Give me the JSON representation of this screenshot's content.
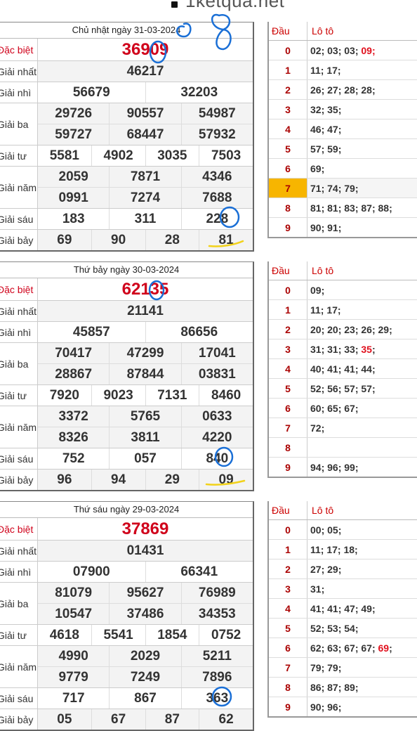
{
  "header": {
    "domain": "1ketqua.net"
  },
  "days": [
    {
      "date": "Chủ nhật ngày 31-03-2024",
      "prizes": [
        {
          "name": "Đặc biệt",
          "lines": [
            [
              "36909"
            ]
          ],
          "special": true
        },
        {
          "name": "Giải nhất",
          "lines": [
            [
              "46217"
            ]
          ]
        },
        {
          "name": "Giải nhì",
          "lines": [
            [
              "56679",
              "32203"
            ]
          ]
        },
        {
          "name": "Giải ba",
          "lines": [
            [
              "29726",
              "90557",
              "54987"
            ],
            [
              "59727",
              "68447",
              "57932"
            ]
          ]
        },
        {
          "name": "Giải tư",
          "lines": [
            [
              "5581",
              "4902",
              "3035",
              "7503"
            ]
          ]
        },
        {
          "name": "Giải năm",
          "lines": [
            [
              "2059",
              "7871",
              "4346"
            ],
            [
              "0991",
              "7274",
              "7688"
            ]
          ]
        },
        {
          "name": "Giải sáu",
          "lines": [
            [
              "183",
              "311",
              "228"
            ]
          ]
        },
        {
          "name": "Giải bảy",
          "lines": [
            [
              "69",
              "90",
              "28",
              "81"
            ]
          ]
        }
      ],
      "loto_header": {
        "dau": "Đầu",
        "loto": "Lô tô"
      },
      "loto": [
        {
          "dau": "0",
          "parts": [
            {
              "t": "02; 03; 03; "
            },
            {
              "t": "09;",
              "red": true
            }
          ]
        },
        {
          "dau": "1",
          "parts": [
            {
              "t": "11; 17;"
            }
          ]
        },
        {
          "dau": "2",
          "parts": [
            {
              "t": "26; 27; 28; 28;"
            }
          ]
        },
        {
          "dau": "3",
          "parts": [
            {
              "t": "32; 35;"
            }
          ]
        },
        {
          "dau": "4",
          "parts": [
            {
              "t": "46; 47;"
            }
          ]
        },
        {
          "dau": "5",
          "parts": [
            {
              "t": "57; 59;"
            }
          ]
        },
        {
          "dau": "6",
          "parts": [
            {
              "t": "69;"
            }
          ]
        },
        {
          "dau": "7",
          "parts": [
            {
              "t": "71; 74; 79;"
            }
          ],
          "highlight": true
        },
        {
          "dau": "8",
          "parts": [
            {
              "t": "81; 81; 83; 87; 88;"
            }
          ]
        },
        {
          "dau": "9",
          "parts": [
            {
              "t": "90; 91;"
            }
          ]
        }
      ]
    },
    {
      "date": "Thứ bảy ngày 30-03-2024",
      "prizes": [
        {
          "name": "Đặc biệt",
          "lines": [
            [
              "62135"
            ]
          ],
          "special": true
        },
        {
          "name": "Giải nhất",
          "lines": [
            [
              "21141"
            ]
          ]
        },
        {
          "name": "Giải nhì",
          "lines": [
            [
              "45857",
              "86656"
            ]
          ]
        },
        {
          "name": "Giải ba",
          "lines": [
            [
              "70417",
              "47299",
              "17041"
            ],
            [
              "28867",
              "87844",
              "03831"
            ]
          ]
        },
        {
          "name": "Giải tư",
          "lines": [
            [
              "7920",
              "9023",
              "7131",
              "8460"
            ]
          ]
        },
        {
          "name": "Giải năm",
          "lines": [
            [
              "3372",
              "5765",
              "0633"
            ],
            [
              "8326",
              "3811",
              "4220"
            ]
          ]
        },
        {
          "name": "Giải sáu",
          "lines": [
            [
              "752",
              "057",
              "840"
            ]
          ]
        },
        {
          "name": "Giải bảy",
          "lines": [
            [
              "96",
              "94",
              "29",
              "09"
            ]
          ]
        }
      ],
      "loto_header": {
        "dau": "Đầu",
        "loto": "Lô tô"
      },
      "loto": [
        {
          "dau": "0",
          "parts": [
            {
              "t": "09;"
            }
          ]
        },
        {
          "dau": "1",
          "parts": [
            {
              "t": "11; 17;"
            }
          ]
        },
        {
          "dau": "2",
          "parts": [
            {
              "t": "20; 20; 23; 26; 29;"
            }
          ]
        },
        {
          "dau": "3",
          "parts": [
            {
              "t": "31; 31; 33; "
            },
            {
              "t": "35",
              "red": true
            },
            {
              "t": ";"
            }
          ]
        },
        {
          "dau": "4",
          "parts": [
            {
              "t": "40; 41; 41; 44;"
            }
          ]
        },
        {
          "dau": "5",
          "parts": [
            {
              "t": "52; 56; 57; 57;"
            }
          ]
        },
        {
          "dau": "6",
          "parts": [
            {
              "t": "60; 65; 67;"
            }
          ]
        },
        {
          "dau": "7",
          "parts": [
            {
              "t": "72;"
            }
          ]
        },
        {
          "dau": "8",
          "parts": [
            {
              "t": ""
            }
          ]
        },
        {
          "dau": "9",
          "parts": [
            {
              "t": "94; 96; 99;"
            }
          ]
        }
      ]
    },
    {
      "date": "Thứ sáu ngày 29-03-2024",
      "prizes": [
        {
          "name": "Đặc biệt",
          "lines": [
            [
              "37869"
            ]
          ],
          "special": true
        },
        {
          "name": "Giải nhất",
          "lines": [
            [
              "01431"
            ]
          ]
        },
        {
          "name": "Giải nhì",
          "lines": [
            [
              "07900",
              "66341"
            ]
          ]
        },
        {
          "name": "Giải ba",
          "lines": [
            [
              "81079",
              "95627",
              "76989"
            ],
            [
              "10547",
              "37486",
              "34353"
            ]
          ]
        },
        {
          "name": "Giải tư",
          "lines": [
            [
              "4618",
              "5541",
              "1854",
              "0752"
            ]
          ]
        },
        {
          "name": "Giải năm",
          "lines": [
            [
              "4990",
              "2029",
              "5211"
            ],
            [
              "9779",
              "7249",
              "7896"
            ]
          ]
        },
        {
          "name": "Giải sáu",
          "lines": [
            [
              "717",
              "867",
              "363"
            ]
          ]
        },
        {
          "name": "Giải bảy",
          "lines": [
            [
              "05",
              "67",
              "87",
              "62"
            ]
          ]
        }
      ],
      "loto_header": {
        "dau": "Đầu",
        "loto": "Lô tô"
      },
      "loto": [
        {
          "dau": "0",
          "parts": [
            {
              "t": "00; 05;"
            }
          ]
        },
        {
          "dau": "1",
          "parts": [
            {
              "t": "11; 17; 18;"
            }
          ]
        },
        {
          "dau": "2",
          "parts": [
            {
              "t": "27; 29;"
            }
          ]
        },
        {
          "dau": "3",
          "parts": [
            {
              "t": "31;"
            }
          ]
        },
        {
          "dau": "4",
          "parts": [
            {
              "t": "41; 41; 47; 49;"
            }
          ]
        },
        {
          "dau": "5",
          "parts": [
            {
              "t": "52; 53; 54;"
            }
          ]
        },
        {
          "dau": "6",
          "parts": [
            {
              "t": "62; 63; 67; 67; "
            },
            {
              "t": "69",
              "red": true
            },
            {
              "t": ";"
            }
          ]
        },
        {
          "dau": "7",
          "parts": [
            {
              "t": "79; 79;"
            }
          ]
        },
        {
          "dau": "8",
          "parts": [
            {
              "t": "86; 87; 89;"
            }
          ]
        },
        {
          "dau": "9",
          "parts": [
            {
              "t": "90; 96;"
            }
          ]
        }
      ]
    }
  ],
  "colors": {
    "special": "#d0021b",
    "highlight": "#f7b500",
    "ink": "#1a6fd6",
    "underline": "#f2d21a"
  }
}
